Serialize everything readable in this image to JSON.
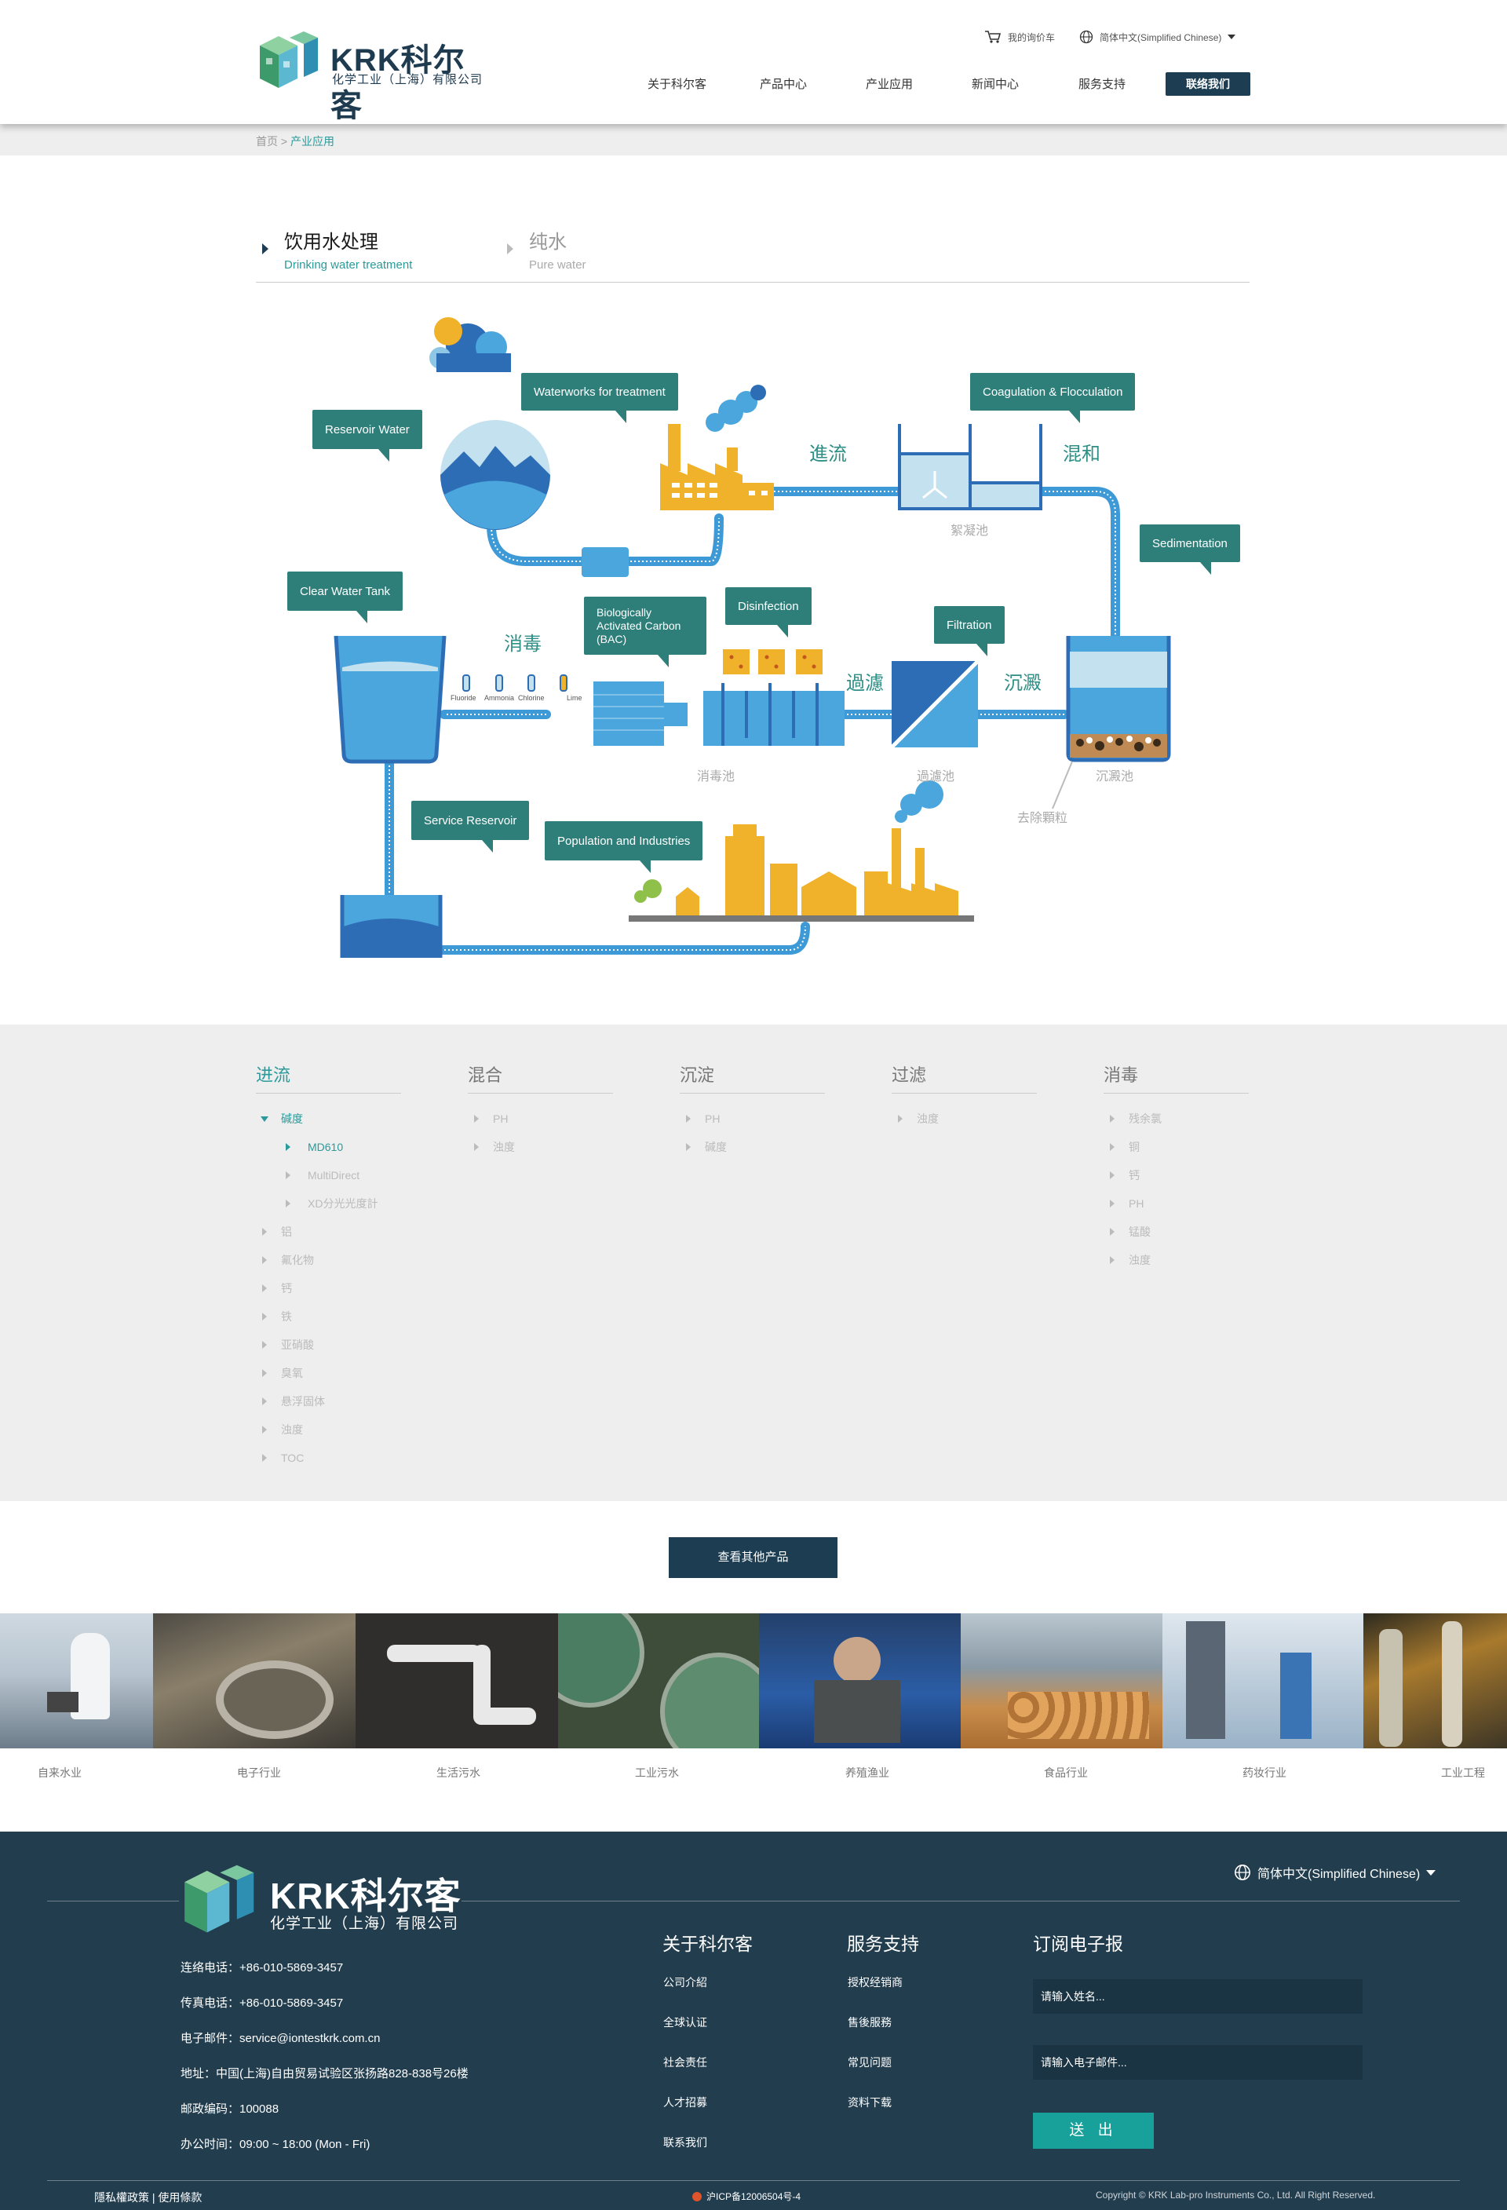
{
  "header": {
    "brand": "KRK科尔客",
    "brand_sub": "化学工业（上海）有限公司",
    "cart_label": "我的询价车",
    "lang_label": "简体中文(Simplified Chinese)",
    "nav": [
      "关于科尔客",
      "产品中心",
      "产业应用",
      "新闻中心",
      "服务支持"
    ],
    "contact_label": "联络我们"
  },
  "breadcrumb": {
    "home": "首页",
    "sep": ">",
    "current": "产业应用"
  },
  "tabs": [
    {
      "cn": "饮用水处理",
      "en": "Drinking water treatment"
    },
    {
      "cn": "纯水",
      "en": "Pure water"
    }
  ],
  "diagram": {
    "callouts": {
      "reservoir": "Reservoir Water",
      "waterworks": "Waterworks for treatment",
      "coagulation": "Coagulation & Flocculation",
      "sedimentation": "Sedimentation",
      "clear_tank": "Clear Water Tank",
      "bac": "Biologically Activated Carbon (BAC)",
      "disinfection": "Disinfection",
      "filtration": "Filtration",
      "service": "Service Reservoir",
      "population": "Population and Industries"
    },
    "stages": {
      "intake": "進流",
      "mix": "混和",
      "disinfect": "消毒",
      "filter": "過濾",
      "settle": "沉澱"
    },
    "pools": {
      "floc": "絮凝池",
      "disinfect": "消毒池",
      "filter": "過濾池",
      "settle": "沉澱池",
      "remove": "去除顆粒"
    },
    "chemicals": [
      "Fluoride",
      "Ammonia",
      "Chlorine",
      "Lime"
    ]
  },
  "tree": [
    {
      "head": "进流",
      "active": true,
      "items": [
        {
          "label": "碱度",
          "state": "open"
        },
        {
          "label": "MD610",
          "state": "sel",
          "sub": true
        },
        {
          "label": "MultiDirect",
          "sub": true
        },
        {
          "label": "XD分光光度計",
          "sub": true
        },
        {
          "label": "铝"
        },
        {
          "label": "氟化物"
        },
        {
          "label": "钙"
        },
        {
          "label": "铁"
        },
        {
          "label": "亚硝酸"
        },
        {
          "label": "臭氧"
        },
        {
          "label": "悬浮固体"
        },
        {
          "label": "浊度"
        },
        {
          "label": "TOC"
        }
      ]
    },
    {
      "head": "混合",
      "items": [
        {
          "label": "PH"
        },
        {
          "label": "浊度"
        }
      ]
    },
    {
      "head": "沉淀",
      "items": [
        {
          "label": "PH"
        },
        {
          "label": "碱度"
        }
      ]
    },
    {
      "head": "过滤",
      "items": [
        {
          "label": "浊度"
        }
      ]
    },
    {
      "head": "消毒",
      "items": [
        {
          "label": "残余氯"
        },
        {
          "label": "铜"
        },
        {
          "label": "钙"
        },
        {
          "label": "PH"
        },
        {
          "label": "锰酸"
        },
        {
          "label": "浊度"
        }
      ]
    }
  ],
  "more_button": "查看其他产品",
  "industries": [
    "自来水业",
    "电子行业",
    "生活污水",
    "工业污水",
    "养殖渔业",
    "食品行业",
    "药妆行业",
    "工业工程"
  ],
  "footer": {
    "brand": "KRK科尔客",
    "brand_sub": "化学工业（上海）有限公司",
    "lang_label": "简体中文(Simplified Chinese)",
    "info": [
      "连络电话：+86-010-5869-3457",
      "传真电话：+86-010-5869-3457",
      "电子邮件：service@iontestkrk.com.cn",
      "地址：中国(上海)自由贸易试验区张扬路828-838号26楼",
      "邮政编码：100088",
      "办公时间：09:00 ~ 18:00 (Mon - Fri)"
    ],
    "col1": {
      "head": "关于科尔客",
      "links": [
        "公司介紹",
        "全球认证",
        "社会责任",
        "人才招募",
        "联系我们"
      ]
    },
    "col2": {
      "head": "服务支持",
      "links": [
        "授权经销商",
        "售後服務",
        "常见问题",
        "资料下载"
      ]
    },
    "newsletter": {
      "head": "订阅电子报",
      "name_ph": "请输入姓名...",
      "email_ph": "请输入电子邮件...",
      "submit": "送 出"
    },
    "policy": "隱私權政策 | 使用條款",
    "icp": "沪ICP备12006504号-4",
    "copyright": "Copyright © KRK Lab-pro Instruments Co., Ltd. All Right Reserved."
  },
  "colors": {
    "navy": "#1d3d52",
    "teal": "#2a9a9a",
    "callout": "#2e7f7a",
    "water": "#4aa6dd",
    "pipe": "#3d9ad6",
    "factory": "#f0b12b"
  }
}
